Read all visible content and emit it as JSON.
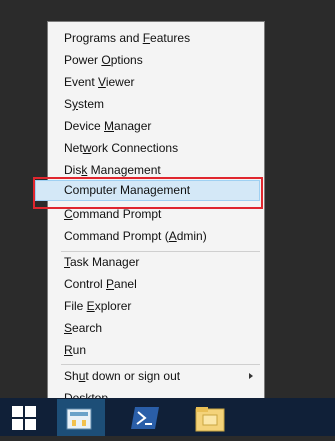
{
  "menu": {
    "items": [
      {
        "pre": "Programs and ",
        "u": "F",
        "post": "eatures"
      },
      {
        "pre": "Power ",
        "u": "O",
        "post": "ptions"
      },
      {
        "pre": "Event ",
        "u": "V",
        "post": "iewer"
      },
      {
        "pre": "S",
        "u": "y",
        "post": "stem"
      },
      {
        "pre": "Device ",
        "u": "M",
        "post": "anager"
      },
      {
        "pre": "Net",
        "u": "w",
        "post": "ork Connections"
      },
      {
        "pre": "Dis",
        "u": "k",
        "post": " Management"
      },
      {
        "pre": "Computer Mana",
        "u": "g",
        "post": "ement"
      },
      {
        "pre": "",
        "u": "C",
        "post": "ommand Prompt"
      },
      {
        "pre": "Command Prompt (",
        "u": "A",
        "post": "dmin)"
      },
      {
        "pre": "",
        "u": "T",
        "post": "ask Manager"
      },
      {
        "pre": "Control ",
        "u": "P",
        "post": "anel"
      },
      {
        "pre": "File ",
        "u": "E",
        "post": "xplorer"
      },
      {
        "pre": "",
        "u": "S",
        "post": "earch"
      },
      {
        "pre": "",
        "u": "R",
        "post": "un"
      },
      {
        "pre": "Sh",
        "u": "u",
        "post": "t down or sign out"
      },
      {
        "pre": "",
        "u": "D",
        "post": "esktop"
      }
    ]
  },
  "colors": {
    "highlight_box": "#e0262e",
    "hover_fill": "#d4e8f7",
    "taskbar": "#102038"
  },
  "taskbar": {
    "icons": [
      "windows-logo-icon",
      "server-manager-icon",
      "powershell-icon",
      "file-explorer-icon"
    ]
  }
}
